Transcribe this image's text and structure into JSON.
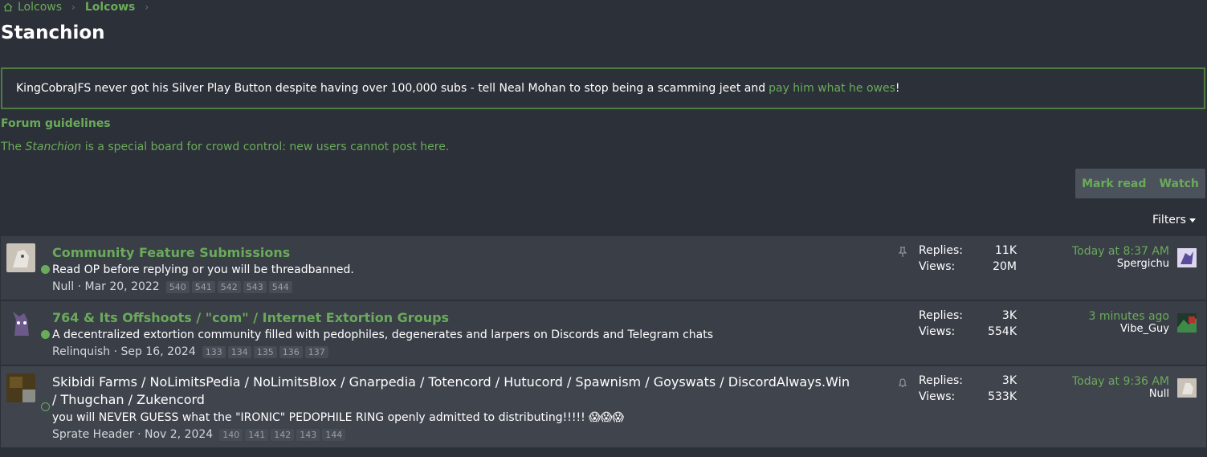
{
  "breadcrumb": {
    "items": [
      "Lolcows",
      "Lolcows"
    ]
  },
  "page_title": "Stanchion",
  "notice": {
    "text": "KingCobraJFS never got his Silver Play Button despite having over 100,000 subs - tell Neal Mohan to stop being a scamming jeet and",
    "link_text": "pay him what he owes",
    "suffix": "!"
  },
  "guidelines": {
    "title": "Forum guidelines",
    "prefix": "The",
    "emphasis": "Stanchion",
    "suffix": "is a special board for crowd control: new users cannot post here."
  },
  "actions": {
    "mark_read": "Mark read",
    "watch": "Watch"
  },
  "filters_label": "Filters",
  "colors": {
    "accent": "#6aab5a",
    "background": "#2c3038",
    "row": "#3a3e47"
  },
  "threads": [
    {
      "title": "Community Feature Submissions",
      "snippet": "Read OP before replying or you will be threadbanned.",
      "author": "Null",
      "date": "Mar 20, 2022",
      "pages": [
        "540",
        "541",
        "542",
        "543",
        "544"
      ],
      "status_icon": "pin-icon",
      "replies_label": "Replies:",
      "replies": "11K",
      "views_label": "Views:",
      "views": "20M",
      "latest_time": "Today at 8:37 AM",
      "latest_user": "Spergichu"
    },
    {
      "title": "764 & Its Offshoots / \"com\" / Internet Extortion Groups",
      "snippet": "A decentralized extortion community filled with pedophiles, degenerates and larpers on Discords and Telegram chats",
      "author": "Relinquish",
      "date": "Sep 16, 2024",
      "pages": [
        "133",
        "134",
        "135",
        "136",
        "137"
      ],
      "replies_label": "Replies:",
      "replies": "3K",
      "views_label": "Views:",
      "views": "554K",
      "latest_time": "3 minutes ago",
      "latest_user": "Vibe_Guy"
    },
    {
      "title": "Skibidi Farms / NoLimitsPedia / NoLimitsBlox / Gnarpedia / Totencord / Hutucord / Spawnism / Goyswats / DiscordAlways.Win / Thugchan / Zukencord",
      "snippet": "you will NEVER GUESS what the \"IRONIC\" PEDOPHILE RING openly admitted to distributing!!!!! 😱😱😱",
      "author": "Sprate Header",
      "date": "Nov 2, 2024",
      "pages": [
        "140",
        "141",
        "142",
        "143",
        "144"
      ],
      "status_icon": "bell-icon",
      "replies_label": "Replies:",
      "replies": "3K",
      "views_label": "Views:",
      "views": "533K",
      "latest_time": "Today at 9:36 AM",
      "latest_user": "Null"
    }
  ]
}
